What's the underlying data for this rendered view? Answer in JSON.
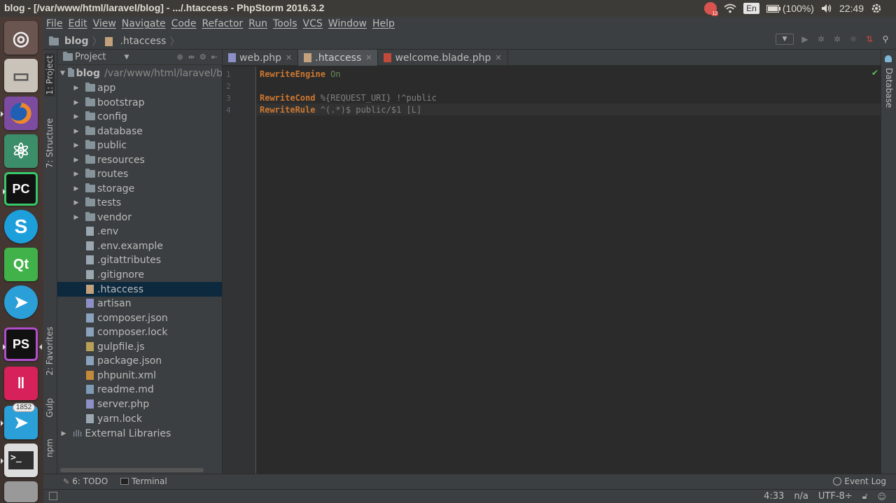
{
  "topbar": {
    "window_title": "blog - [/var/www/html/laravel/blog] - .../.htaccess - PhpStorm 2016.3.2",
    "notification_count": "12",
    "language": "En",
    "battery": "(100%)",
    "time": "22:49"
  },
  "launcher": {
    "items": [
      {
        "name": "ubuntu-dash",
        "glyph": "◎"
      },
      {
        "name": "files",
        "glyph": "▭"
      },
      {
        "name": "firefox",
        "glyph": "●"
      },
      {
        "name": "atom",
        "glyph": "⚛"
      },
      {
        "name": "pycharm",
        "glyph": "PC"
      },
      {
        "name": "skype",
        "glyph": "S"
      },
      {
        "name": "qt-creator",
        "glyph": "Qt"
      },
      {
        "name": "telegram",
        "glyph": "➤"
      },
      {
        "name": "phpstorm",
        "glyph": "PS"
      },
      {
        "name": "gitkraken",
        "glyph": "ǁ"
      },
      {
        "name": "telegram-2",
        "glyph": "➤",
        "badge": "1852"
      },
      {
        "name": "terminal",
        "glyph": ">_"
      }
    ]
  },
  "menubar": {
    "items": [
      "File",
      "Edit",
      "View",
      "Navigate",
      "Code",
      "Refactor",
      "Run",
      "Tools",
      "VCS",
      "Window",
      "Help"
    ]
  },
  "navbar": {
    "crumb_project": "blog",
    "crumb_file": ".htaccess"
  },
  "left_tool_tabs": {
    "project": "1: Project",
    "structure": "7: Structure",
    "favorites": "2: Favorites",
    "gulp": "Gulp",
    "npm": "npm"
  },
  "project_panel": {
    "header": "Project",
    "root_name": "blog",
    "root_path": "/var/www/html/laravel/b",
    "folders": [
      "app",
      "bootstrap",
      "config",
      "database",
      "public",
      "resources",
      "routes",
      "storage",
      "tests",
      "vendor"
    ],
    "files": [
      {
        "name": ".env",
        "kind": "txt"
      },
      {
        "name": ".env.example",
        "kind": "txt"
      },
      {
        "name": ".gitattributes",
        "kind": "txt"
      },
      {
        "name": ".gitignore",
        "kind": "txt"
      },
      {
        "name": ".htaccess",
        "kind": "ht",
        "selected": true
      },
      {
        "name": "artisan",
        "kind": "php"
      },
      {
        "name": "composer.json",
        "kind": "json"
      },
      {
        "name": "composer.lock",
        "kind": "json"
      },
      {
        "name": "gulpfile.js",
        "kind": "js"
      },
      {
        "name": "package.json",
        "kind": "json"
      },
      {
        "name": "phpunit.xml",
        "kind": "xml"
      },
      {
        "name": "readme.md",
        "kind": "md"
      },
      {
        "name": "server.php",
        "kind": "php"
      },
      {
        "name": "yarn.lock",
        "kind": "txt"
      }
    ],
    "external": "External Libraries"
  },
  "tabs": [
    {
      "label": "web.php",
      "active": false
    },
    {
      "label": ".htaccess",
      "active": true
    },
    {
      "label": "welcome.blade.php",
      "active": false
    }
  ],
  "editor": {
    "line_numbers": [
      "1",
      "2",
      "3",
      "4"
    ],
    "lines": [
      {
        "kw": "RewriteEngine",
        "rest": " On",
        "rest_class": "val"
      },
      {
        "kw": "",
        "rest": "",
        "rest_class": "arg"
      },
      {
        "kw": "RewriteCond",
        "rest": " %{REQUEST_URI} !^public",
        "rest_class": "arg"
      },
      {
        "kw": "RewriteRule",
        "rest": " ^(.*)$ public/$1 [L]",
        "rest_class": "arg"
      }
    ]
  },
  "right_tool_tabs": {
    "database": "Database"
  },
  "bottom_tools": {
    "todo": "6: TODO",
    "terminal": "Terminal",
    "event_log": "Event Log"
  },
  "statusbar": {
    "position": "4:33",
    "line_sep": "n/a",
    "encoding": "UTF-8÷"
  },
  "colors": {
    "keyword": "#cc7832",
    "value": "#6a8759",
    "selection": "#0d293e",
    "editor_bg": "#2b2b2b"
  }
}
